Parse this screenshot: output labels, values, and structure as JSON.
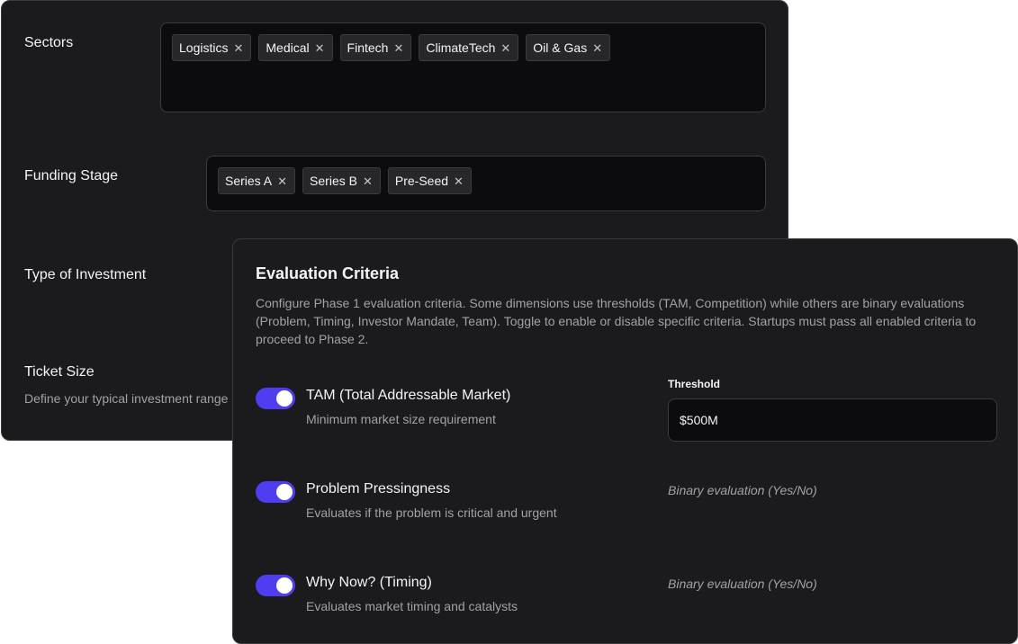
{
  "filters": {
    "sectors": {
      "label": "Sectors",
      "tags": [
        "Logistics",
        "Medical",
        "Fintech",
        "ClimateTech",
        "Oil & Gas"
      ]
    },
    "funding_stage": {
      "label": "Funding Stage",
      "tags": [
        "Series A",
        "Series B",
        "Pre-Seed"
      ]
    },
    "type_of_investment": {
      "label": "Type of Investment"
    },
    "ticket_size": {
      "label": "Ticket Size",
      "description": "Define your typical investment range"
    },
    "remove_glyph": "✕"
  },
  "evaluation": {
    "title": "Evaluation Criteria",
    "description": "Configure Phase 1 evaluation criteria. Some dimensions use thresholds (TAM, Competition) while others are binary evaluations (Problem, Timing, Investor Mandate, Team). Toggle to enable or disable specific criteria. Startups must pass all enabled criteria to proceed to Phase 2.",
    "threshold_label": "Threshold",
    "criteria": [
      {
        "title": "TAM (Total Addressable Market)",
        "subtitle": "Minimum market size requirement",
        "enabled": true,
        "threshold_value": "$500M"
      },
      {
        "title": "Problem Pressingness",
        "subtitle": "Evaluates if the problem is critical and urgent",
        "enabled": true,
        "binary_label": "Binary evaluation (Yes/No)"
      },
      {
        "title": "Why Now? (Timing)",
        "subtitle": "Evaluates market timing and catalysts",
        "enabled": true,
        "binary_label": "Binary evaluation (Yes/No)"
      }
    ]
  },
  "colors": {
    "card_bg": "#1b1b1e",
    "input_bg": "#0c0c0e",
    "border": "#3a3a3f",
    "toggle_on": "#4f3df0",
    "text_primary": "#f4f4f5",
    "text_muted": "#a1a1aa"
  }
}
